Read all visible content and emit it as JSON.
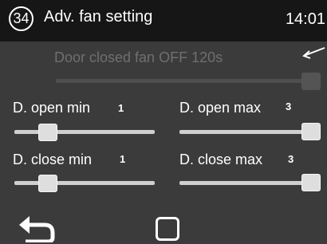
{
  "header": {
    "page_number": "34",
    "title": "Adv. fan setting",
    "time": "14:01"
  },
  "door_closed_fan": {
    "label": "Door closed fan OFF 120s",
    "slider_level": 1.0,
    "enabled": false
  },
  "params": {
    "open_min": {
      "label": "D. open min",
      "value": "1",
      "slider_level": 0.0
    },
    "open_max": {
      "label": "D. open max",
      "value": "3",
      "slider_level": 1.0
    },
    "close_min": {
      "label": "D. close min",
      "value": "1",
      "slider_level": 0.0
    },
    "close_max": {
      "label": "D. close max",
      "value": "3",
      "slider_level": 1.0
    }
  },
  "icons": {
    "back": "back-arrow-icon",
    "stop": "stop-square-icon",
    "indicator": "arrow-pointer-icon"
  },
  "colors": {
    "background": "#3b3b3b",
    "header": "#161616",
    "disabled_text": "#6f6f6f"
  }
}
